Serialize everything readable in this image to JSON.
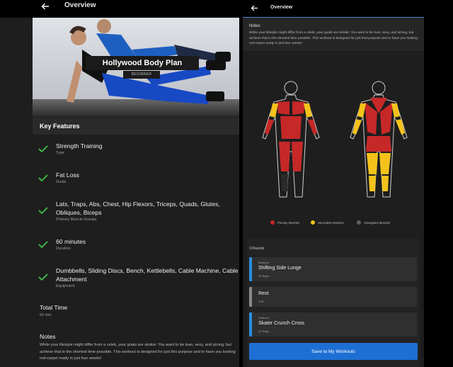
{
  "left": {
    "header": {
      "title": "Overview"
    },
    "hero": {
      "title": "Hollywood Body Plan",
      "badge": "BEGINNER"
    },
    "key_features": {
      "title": "Key Features",
      "items": [
        {
          "title": "Strength Training",
          "subtitle": "Type"
        },
        {
          "title": "Fat Loss",
          "subtitle": "Goals"
        },
        {
          "title": "Lats, Traps, Abs, Chest, Hip Flexors, Triceps, Quads, Glutes, Obliques, Biceps",
          "subtitle": "Primary Muscle Groups"
        },
        {
          "title": "60 minutes",
          "subtitle": "Duration"
        },
        {
          "title": "Dumbbells, Sliding Discs, Bench, Kettlebells, Cable Machine, Cable Attachment",
          "subtitle": "Equipment"
        }
      ]
    },
    "total_time": {
      "label": "Total Time",
      "value": "60 min"
    },
    "notes": {
      "label": "Notes",
      "text": "While your lifestyle might differ from a celeb, your goals are similar: You want to be lean, sexy, and strong, but achieve that in the shortest time possible. This workout is designed for just this purpose and to have you looking red-carpet ready in just four weeks!"
    }
  },
  "right": {
    "header": {
      "title": "Overview"
    },
    "notes": {
      "label": "Notes",
      "text": "While your lifestyle might differ from a celeb, your goals are similar: You want to be lean, sexy, and strong, but achieve that in the shortest time possible. This workout is designed for just that purpose and to have you looking red-carpet ready in just four weeks!"
    },
    "legend": [
      {
        "label": "Primary Muscles",
        "color": "#c62828"
      },
      {
        "label": "Secondary Muscles",
        "color": "#f4c21b"
      },
      {
        "label": "Untargeted Muscles",
        "color": "#616161"
      }
    ],
    "colors": {
      "primary": "#c62828",
      "secondary": "#f4c21b",
      "accent": "#1e6fd4",
      "card_bar": "#2b8fe0",
      "rest_bar": "#8a8a8a"
    },
    "rounds": {
      "title": "3 Rounds",
      "cards": [
        {
          "type": "Workout",
          "name": "Shifting Side Lunge",
          "reps": "20 Reps"
        },
        {
          "type": "",
          "name": "Rest",
          "reps": "0:30"
        },
        {
          "type": "Workout",
          "name": "Skater Crunch Cross",
          "reps": "20 Reps"
        }
      ]
    },
    "save_button": "Save to My Workouts"
  },
  "icons": {
    "back": "arrow-left-icon",
    "check": "check-icon"
  }
}
